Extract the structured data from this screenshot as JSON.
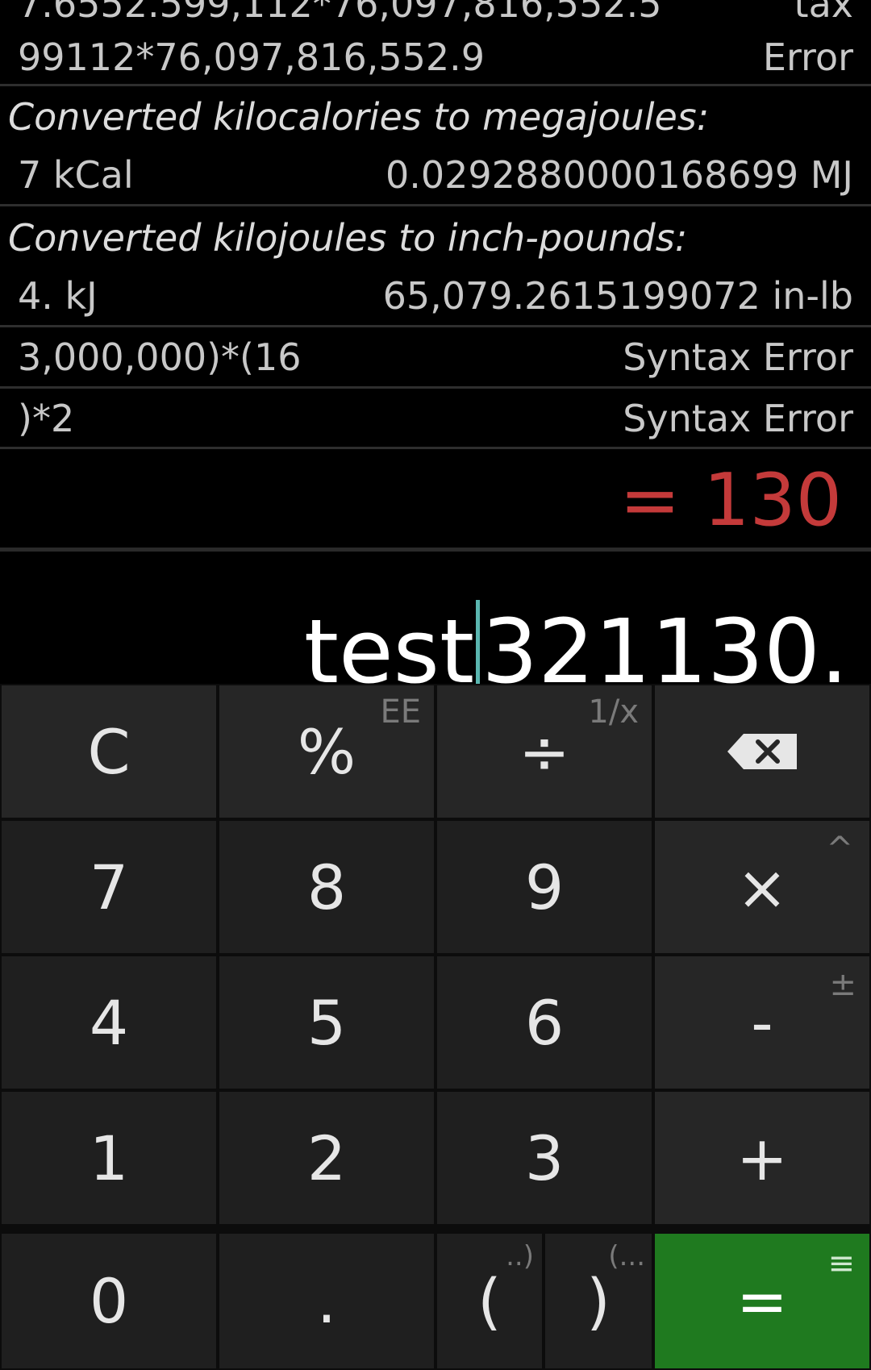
{
  "history": {
    "r1_left": "7.6552.599,112*76,097,816,552.5",
    "r1_right": "tax",
    "r2_left": "99112*76,097,816,552.9",
    "r2_right": "Error",
    "h1": "Converted kilocalories to megajoules:",
    "r3_left": "7 kCal",
    "r3_right": "0.0292880000168699 MJ",
    "h2": "Converted kilojoules to inch-pounds:",
    "r4_left": "4. kJ",
    "r4_right": "65,079.2615199072 in-lb",
    "r5_left": "3,000,000)*(16",
    "r5_right": "Syntax Error",
    "r6_left": ")*2",
    "r6_right": "Syntax Error"
  },
  "result": "= 130",
  "input": {
    "before": "test",
    "after": "321130."
  },
  "keys": {
    "clear": "C",
    "percent": "%",
    "percent_sub": "EE",
    "divide": "÷",
    "divide_sub": "1/x",
    "seven": "7",
    "eight": "8",
    "nine": "9",
    "multiply": "×",
    "multiply_sub": "^",
    "four": "4",
    "five": "5",
    "six": "6",
    "minus": "-",
    "minus_sub": "±",
    "one": "1",
    "two": "2",
    "three": "3",
    "plus": "+",
    "zero": "0",
    "dot": ".",
    "lparen": "(",
    "lparen_sub": "..)",
    "rparen": ")",
    "rparen_sub": "(...",
    "equals": "=",
    "equals_sub": "≡"
  },
  "colors": {
    "result": "#c43a3a",
    "equals_key": "#1f7a1f",
    "cursor": "#5ab6b0"
  }
}
